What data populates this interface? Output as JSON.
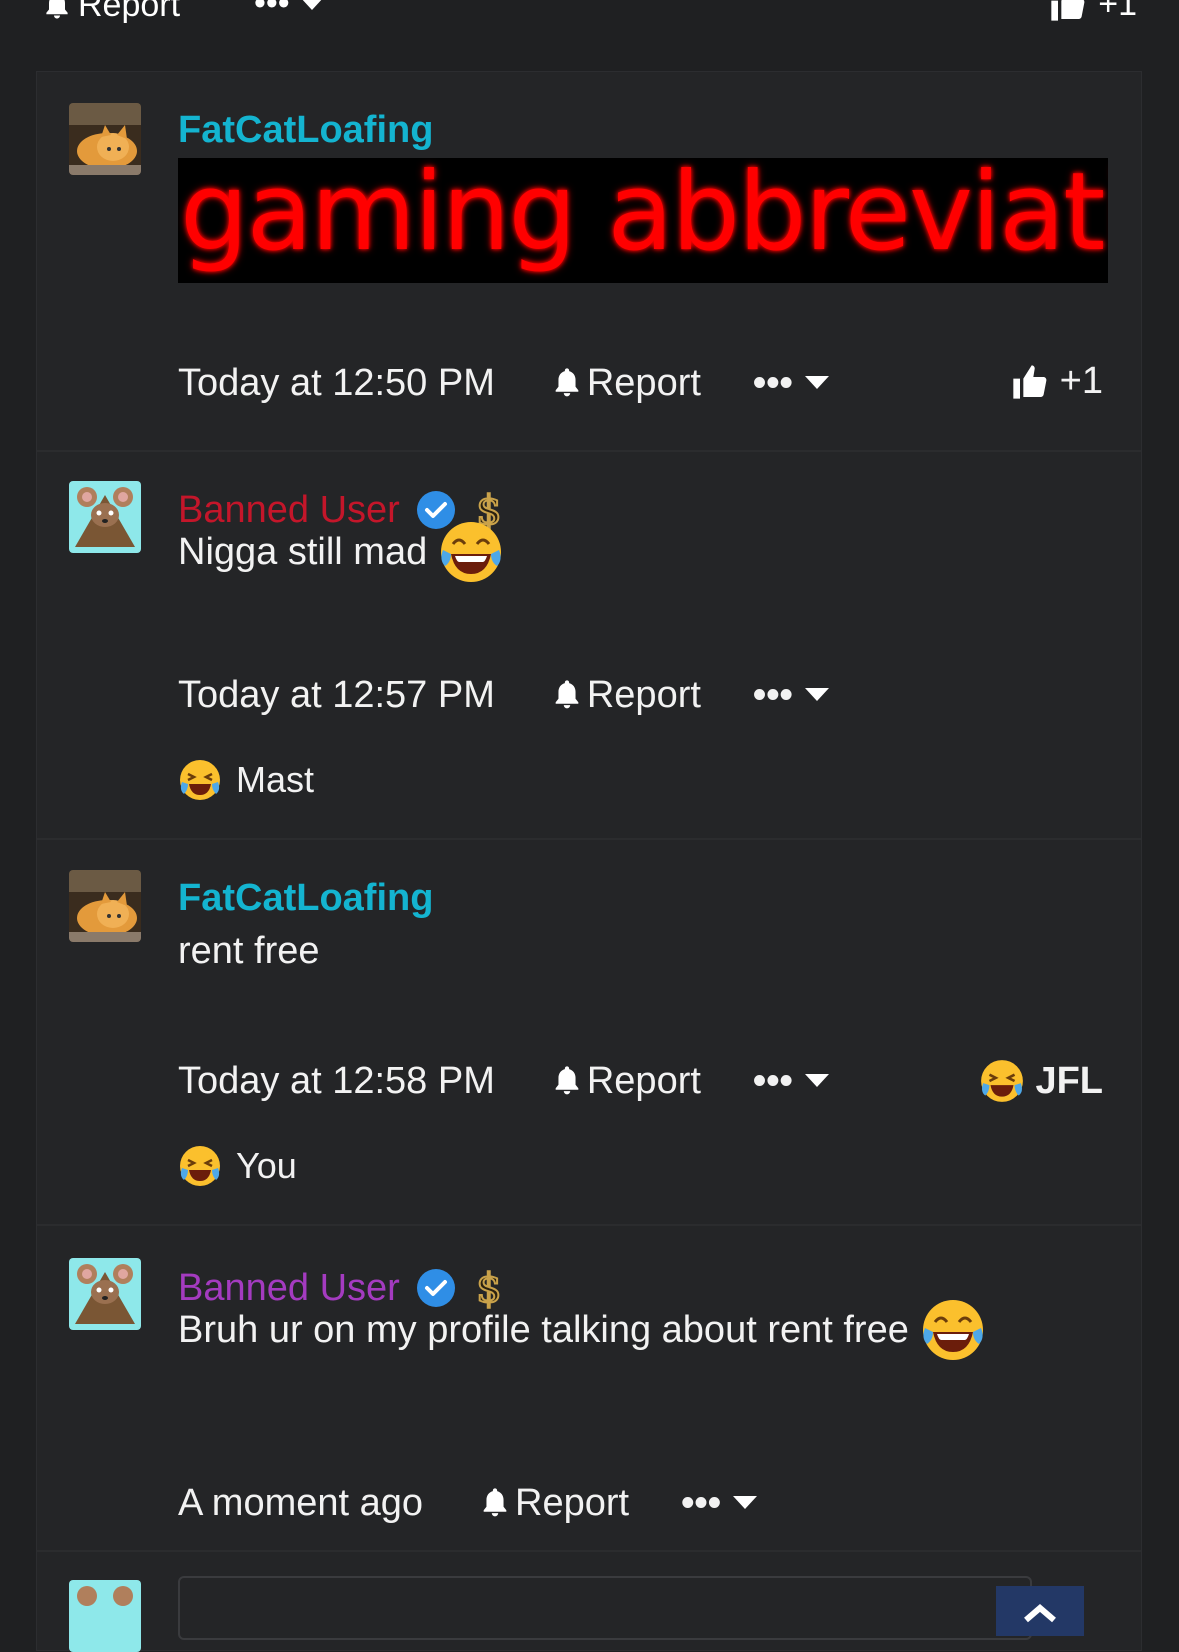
{
  "top_bar": {
    "report_label": "Report",
    "reaction_count": "+1"
  },
  "comments": [
    {
      "username": "FatCatLoafing",
      "banner_text": "gaming abbreviation",
      "timestamp": "Today at 12:50 PM",
      "report_label": "Report",
      "reaction_count": "+1"
    },
    {
      "username": "Banned User",
      "message": "Nigga still mad",
      "timestamp": "Today at 12:57 PM",
      "report_label": "Report",
      "reaction_summary": "Mast"
    },
    {
      "username": "FatCatLoafing",
      "message": "rent free",
      "timestamp": "Today at 12:58 PM",
      "report_label": "Report",
      "reaction_label": "JFL",
      "reaction_summary": "You"
    },
    {
      "username": "Banned User",
      "message": "Bruh ur on my profile talking about rent free",
      "timestamp": "A moment ago",
      "report_label": "Report"
    }
  ],
  "colors": {
    "background": "#1f2022",
    "card": "#242527",
    "username_cyan": "#14b4d0",
    "username_red": "#c4162a",
    "username_purple": "#a43bc0",
    "verified_blue": "#2f8ee6",
    "scroll_top_button": "#233866"
  },
  "icons": [
    "bell-icon",
    "more-dots-icon",
    "caret-down-icon",
    "thumbs-up-icon",
    "verified-badge-icon",
    "dollar-sign-icon",
    "tears-of-joy-emoji",
    "laughing-crying-emoji",
    "chevron-up-icon"
  ]
}
